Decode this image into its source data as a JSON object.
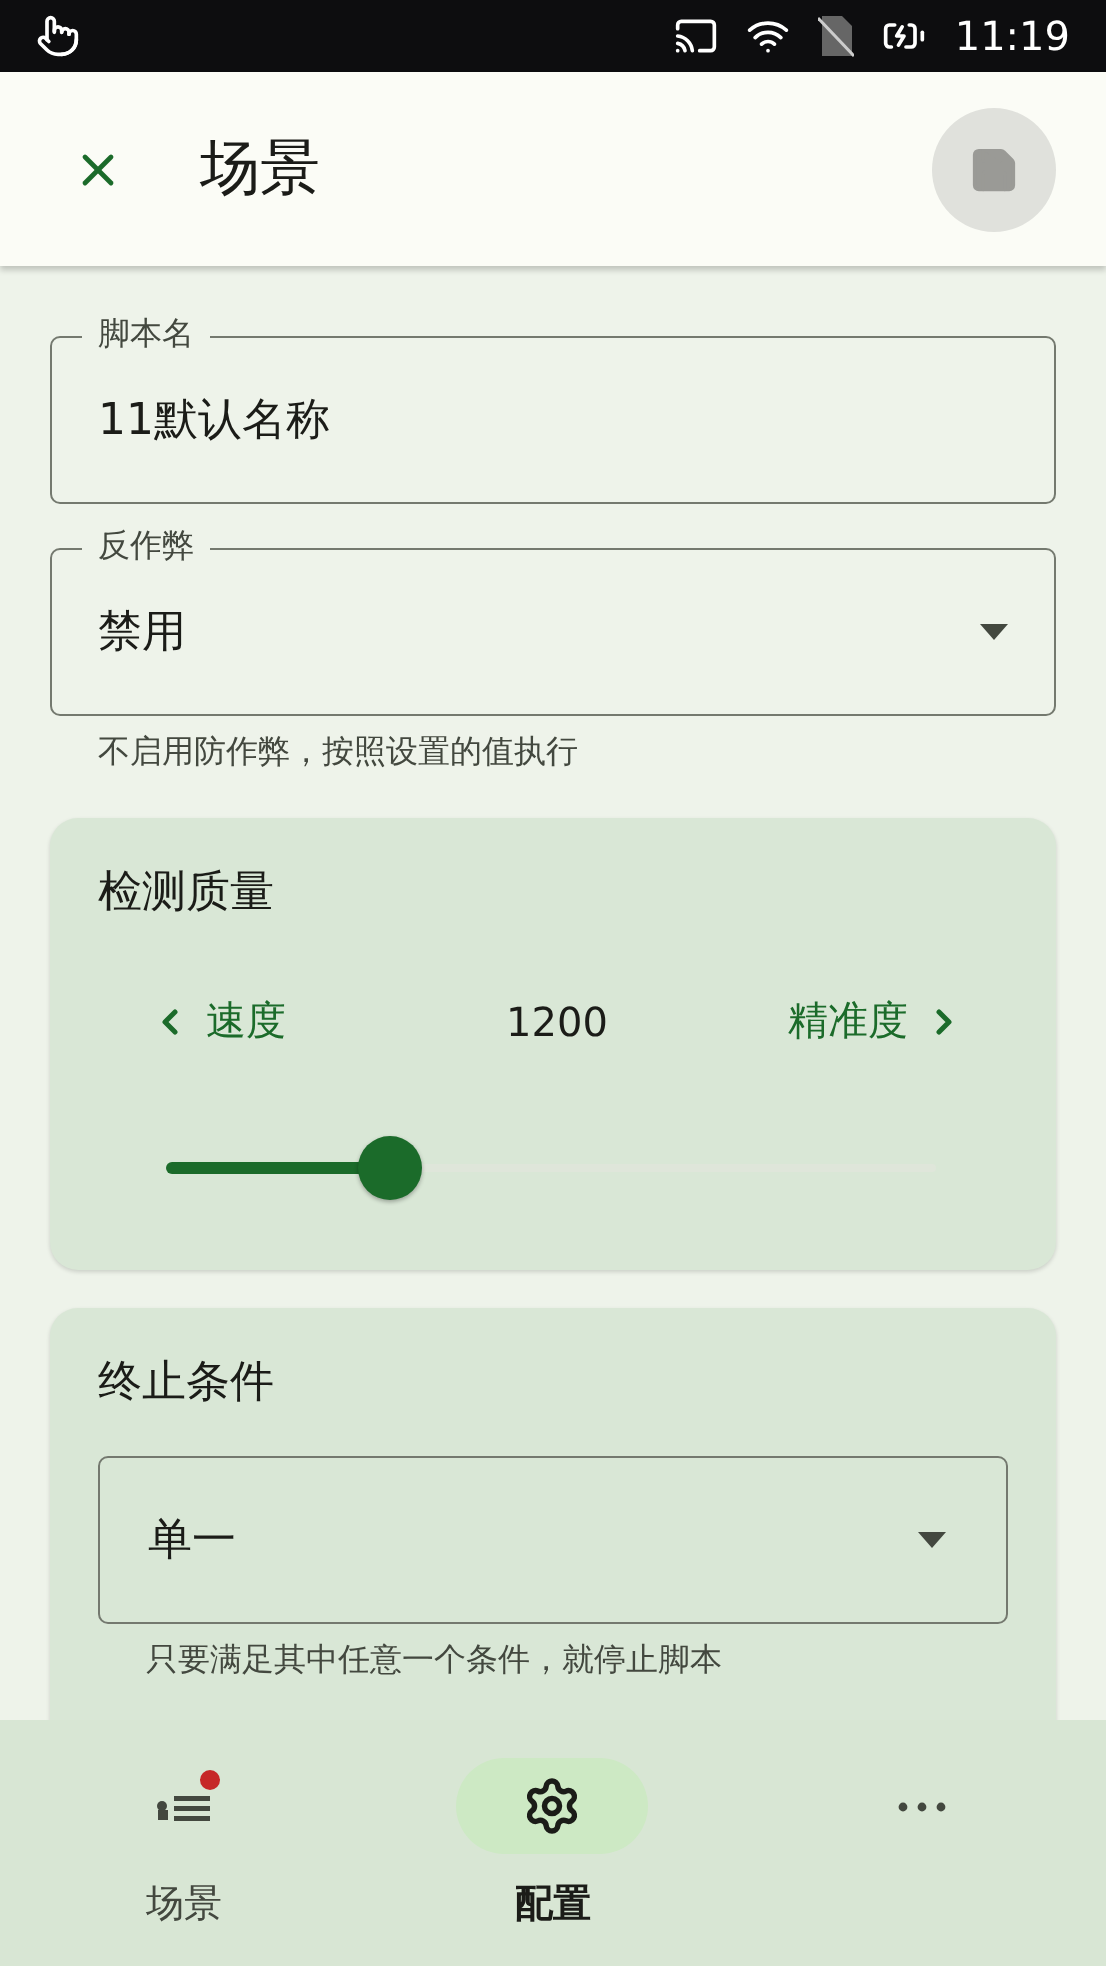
{
  "status_bar": {
    "time": "11:19"
  },
  "app_bar": {
    "title": "场景"
  },
  "script_name": {
    "label": "脚本名",
    "value": "11默认名称"
  },
  "anti_cheat": {
    "label": "反作弊",
    "value": "禁用",
    "helper": "不启用防作弊，按照设置的值执行"
  },
  "detection_quality": {
    "title": "检测质量",
    "left_label": "速度",
    "value": "1200",
    "right_label": "精准度",
    "level": 0.29
  },
  "stop_condition": {
    "title": "终止条件",
    "value": "单一",
    "helper": "只要满足其中任意一个条件，就停止脚本"
  },
  "bottom_nav": [
    {
      "kind": "scenes",
      "label": "场景",
      "selected": false,
      "badge": true
    },
    {
      "kind": "settings",
      "label": "配置",
      "selected": true,
      "badge": false
    },
    {
      "kind": "more",
      "selected": false,
      "badge": false
    }
  ]
}
